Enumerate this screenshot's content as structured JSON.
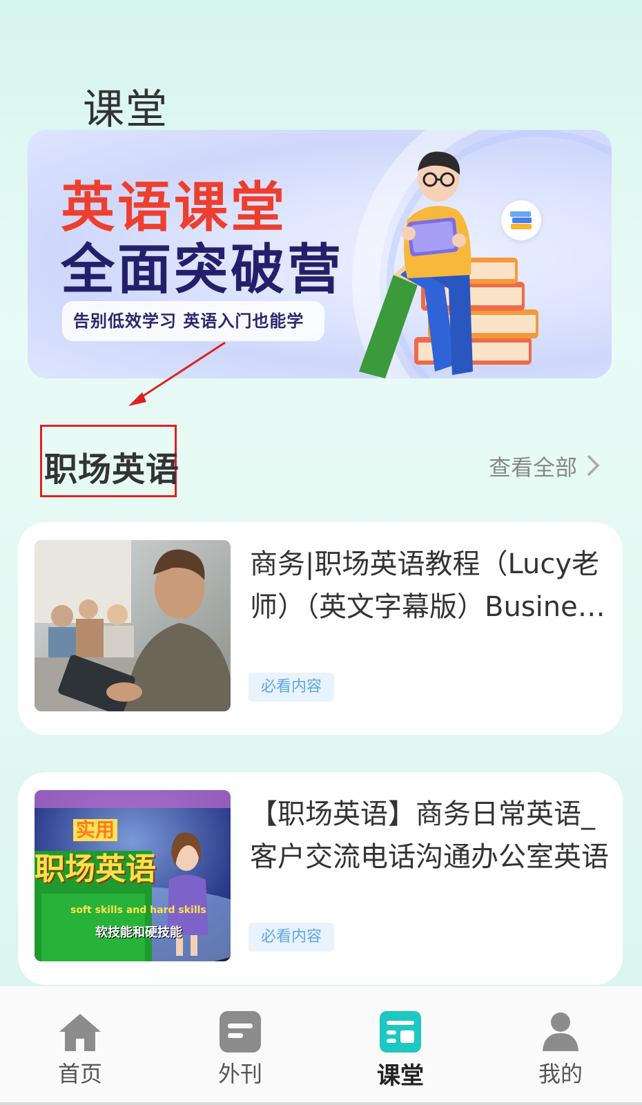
{
  "page": {
    "title": "课堂"
  },
  "banner": {
    "title_line1": "英语课堂",
    "title_line2": "全面突破营",
    "subtitle": "告别低效学习 英语入门也能学"
  },
  "section": {
    "title": "职场英语",
    "view_all": "查看全部"
  },
  "courses": [
    {
      "title": "商务|职场英语教程（Lucy老师）（英文字幕版）Business English",
      "tag": "必看内容",
      "thumb_text_top": "",
      "thumb_text_main": ""
    },
    {
      "title": "【职场英语】商务日常英语_客户交流电话沟通办公室英语",
      "tag": "必看内容",
      "thumb_text_top": "实用",
      "thumb_text_main": "职场英语",
      "thumb_text_en": "soft skills and hard skills",
      "thumb_text_cn": "软技能和硬技能"
    }
  ],
  "bottom_nav": [
    {
      "label": "首页",
      "icon": "home-icon",
      "active": false
    },
    {
      "label": "外刊",
      "icon": "journal-icon",
      "active": false
    },
    {
      "label": "课堂",
      "icon": "classroom-icon",
      "active": true
    },
    {
      "label": "我的",
      "icon": "profile-icon",
      "active": false
    }
  ],
  "colors": {
    "accent": "#1ec7c0",
    "banner_red": "#ee3e2e",
    "banner_navy": "#23206b",
    "tag_text": "#5ba6e8",
    "annotation_red": "#e02020"
  }
}
